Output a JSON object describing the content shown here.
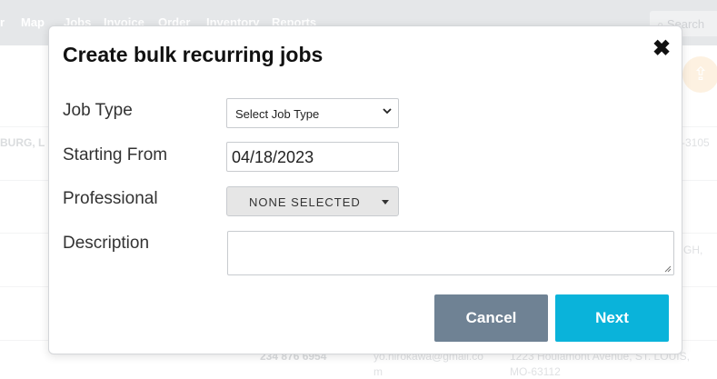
{
  "background": {
    "nav": [
      "r",
      "Map",
      "Jobs",
      "Invoice",
      "Order",
      "Inventory",
      "Reports"
    ],
    "search_placeholder": "Search",
    "row_text": {
      "left_city": "BURG, L",
      "right_code": "-3105",
      "right_city": "GH,",
      "phone": "234 876 6954",
      "email_line1": "yo.hirokawa@gmail.co",
      "email_line2": "m",
      "address_line1": "1223 Houlamont Avenue, ST. LOUIS,",
      "address_line2": "MO-63112"
    }
  },
  "modal": {
    "title": "Create bulk recurring jobs",
    "close_label": "✖",
    "fields": {
      "job_type": {
        "label": "Job Type",
        "selected": "Select Job Type"
      },
      "starting_from": {
        "label": "Starting From",
        "value": "04/18/2023"
      },
      "professional": {
        "label": "Professional",
        "selected": "NONE SELECTED"
      },
      "description": {
        "label": "Description",
        "value": ""
      }
    },
    "buttons": {
      "cancel": "Cancel",
      "next": "Next"
    }
  },
  "colors": {
    "nav_bg": "#d0d4d8",
    "cancel_bg": "#6f8294",
    "next_bg": "#0ab3da",
    "share_bg": "#fbe6c9"
  }
}
